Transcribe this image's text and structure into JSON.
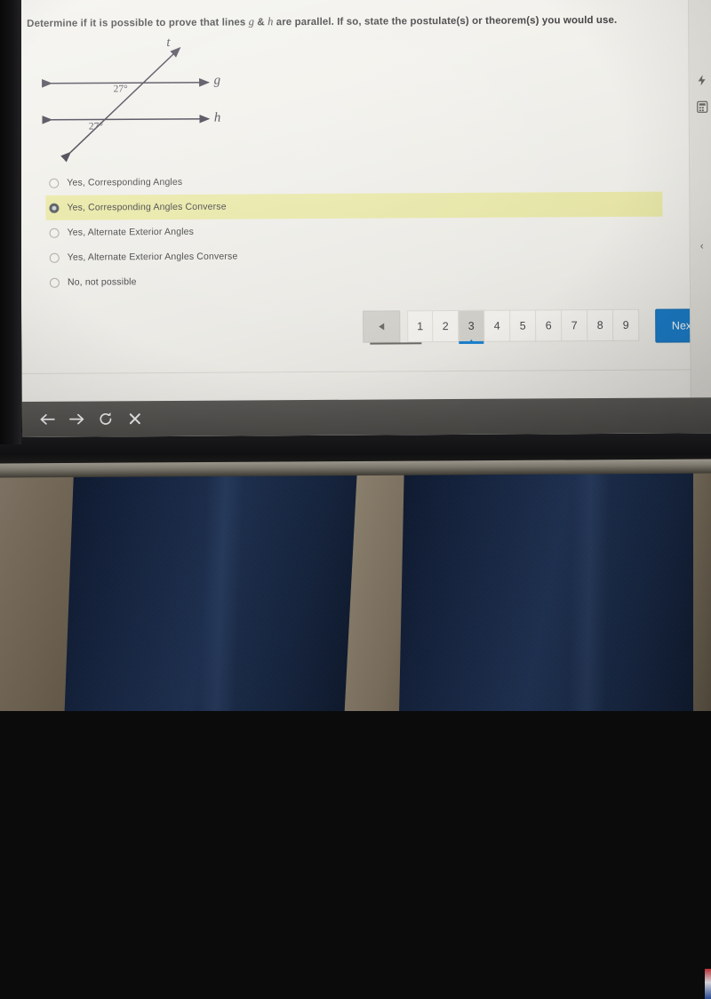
{
  "question": {
    "text_before_g": "Determine if it is possible to prove that lines ",
    "var_g": "g",
    "amp": " & ",
    "var_h": "h",
    "text_after": " are parallel.  If so, state the postulate(s) or theorem(s) you would use."
  },
  "diagram": {
    "line_t_label": "t",
    "line_g_label": "g",
    "line_h_label": "h",
    "angle_upper": "27°",
    "angle_lower": "27°"
  },
  "options": [
    {
      "label": "Yes, Corresponding Angles",
      "selected": false
    },
    {
      "label": "Yes, Corresponding Angles Converse",
      "selected": true
    },
    {
      "label": "Yes, Alternate Exterior Angles",
      "selected": false
    },
    {
      "label": "Yes, Alternate Exterior Angles Converse",
      "selected": false
    },
    {
      "label": "No, not possible",
      "selected": false
    }
  ],
  "pager": {
    "prev_icon": "triangle-left-icon",
    "pages": [
      "1",
      "2",
      "3",
      "4",
      "5",
      "6",
      "7",
      "8",
      "9"
    ],
    "active_page": "3",
    "next_label": "Next",
    "next_icon": "triangle-right-icon"
  },
  "rail": {
    "icons": [
      "bolt-icon",
      "calculator-icon"
    ],
    "collapse_label": "‹"
  },
  "browser_bar": {
    "back_icon": "arrow-left-icon",
    "forward_icon": "arrow-right-icon",
    "reload_icon": "reload-icon",
    "close_icon": "close-icon"
  },
  "colors": {
    "highlight": "#ecebab",
    "next_button": "#1c80cd",
    "active_page_underline": "#1c84d6",
    "page_background": "#f2f1ec",
    "browser_bar": "#5d5c59"
  }
}
